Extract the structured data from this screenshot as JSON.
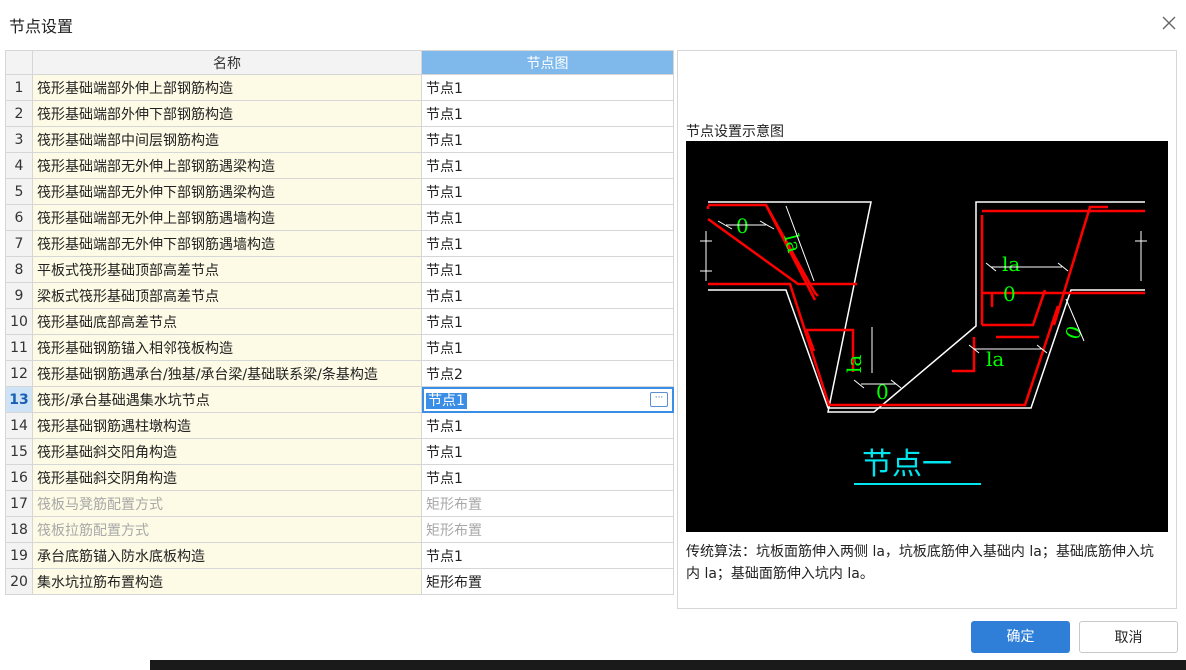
{
  "window": {
    "title": "节点设置"
  },
  "table": {
    "headers": {
      "name": "名称",
      "node": "节点图"
    },
    "rows": [
      {
        "idx": "1",
        "name": "筏形基础端部外伸上部钢筋构造",
        "value": "节点1"
      },
      {
        "idx": "2",
        "name": "筏形基础端部外伸下部钢筋构造",
        "value": "节点1"
      },
      {
        "idx": "3",
        "name": "筏形基础端部中间层钢筋构造",
        "value": "节点1"
      },
      {
        "idx": "4",
        "name": "筏形基础端部无外伸上部钢筋遇梁构造",
        "value": "节点1"
      },
      {
        "idx": "5",
        "name": "筏形基础端部无外伸下部钢筋遇梁构造",
        "value": "节点1"
      },
      {
        "idx": "6",
        "name": "筏形基础端部无外伸上部钢筋遇墙构造",
        "value": "节点1"
      },
      {
        "idx": "7",
        "name": "筏形基础端部无外伸下部钢筋遇墙构造",
        "value": "节点1"
      },
      {
        "idx": "8",
        "name": "平板式筏形基础顶部高差节点",
        "value": "节点1"
      },
      {
        "idx": "9",
        "name": "梁板式筏形基础顶部高差节点",
        "value": "节点1"
      },
      {
        "idx": "10",
        "name": "筏形基础底部高差节点",
        "value": "节点1"
      },
      {
        "idx": "11",
        "name": "筏形基础钢筋锚入相邻筏板构造",
        "value": "节点1"
      },
      {
        "idx": "12",
        "name": "筏形基础钢筋遇承台/独基/承台梁/基础联系梁/条基构造",
        "value": "节点2"
      },
      {
        "idx": "13",
        "name": "筏形/承台基础遇集水坑节点",
        "value": "节点1"
      },
      {
        "idx": "14",
        "name": "筏形基础钢筋遇柱墩构造",
        "value": "节点1"
      },
      {
        "idx": "15",
        "name": "筏形基础斜交阳角构造",
        "value": "节点1"
      },
      {
        "idx": "16",
        "name": "筏形基础斜交阴角构造",
        "value": "节点1"
      },
      {
        "idx": "17",
        "name": "筏板马凳筋配置方式",
        "value": "矩形布置"
      },
      {
        "idx": "18",
        "name": "筏板拉筋配置方式",
        "value": "矩形布置"
      },
      {
        "idx": "19",
        "name": "承台底筋锚入防水底板构造",
        "value": "节点1"
      },
      {
        "idx": "20",
        "name": "集水坑拉筋布置构造",
        "value": "矩形布置"
      }
    ]
  },
  "preview": {
    "label": "节点设置示意图",
    "diagram": {
      "title": "节点一",
      "dim_la": "la",
      "dim_zero": "0",
      "colors": {
        "rebar": "#ff0000",
        "outline": "#ffffff",
        "dim": "#00ff00",
        "title": "#00e5ee"
      }
    },
    "description": "传统算法：坑板面筋伸入两侧 la，坑板底筋伸入基础内 la；基础底筋伸入坑内 la；基础面筋伸入坑内 la。"
  },
  "buttons": {
    "ok": "确定",
    "cancel": "取消"
  },
  "colors": {
    "accent": "#2f7fd8",
    "header_selected": "#7fb9ec",
    "name_cell": "#fdfbe5"
  }
}
